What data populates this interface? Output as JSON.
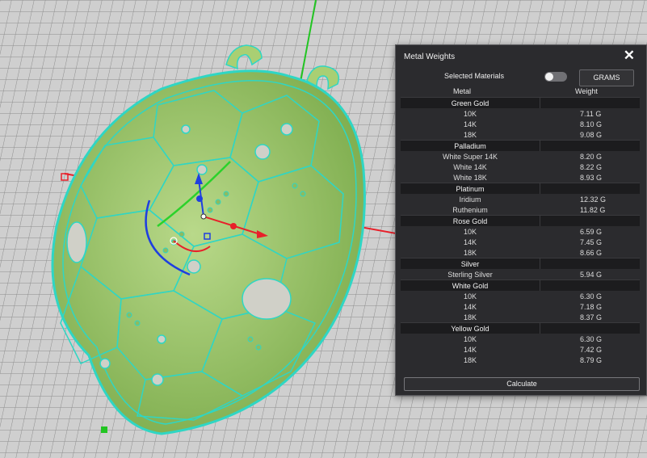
{
  "panel": {
    "title": "Metal Weights",
    "selected_materials_label": "Selected Materials",
    "unit_button": "GRAMS",
    "col_metal": "Metal",
    "col_weight": "Weight",
    "calculate_label": "Calculate",
    "groups": [
      {
        "name": "Green Gold",
        "rows": [
          {
            "metal": "10K",
            "weight": "7.11 G"
          },
          {
            "metal": "14K",
            "weight": "8.10 G"
          },
          {
            "metal": "18K",
            "weight": "9.08 G"
          }
        ]
      },
      {
        "name": "Palladium",
        "rows": [
          {
            "metal": "White Super 14K",
            "weight": "8.20 G"
          },
          {
            "metal": "White 14K",
            "weight": "8.22 G"
          },
          {
            "metal": "White 18K",
            "weight": "8.93 G"
          }
        ]
      },
      {
        "name": "Platinum",
        "rows": [
          {
            "metal": "Iridium",
            "weight": "12.32 G"
          },
          {
            "metal": "Ruthenium",
            "weight": "11.82 G"
          }
        ]
      },
      {
        "name": "Rose Gold",
        "rows": [
          {
            "metal": "10K",
            "weight": "6.59 G"
          },
          {
            "metal": "14K",
            "weight": "7.45 G"
          },
          {
            "metal": "18K",
            "weight": "8.66 G"
          }
        ]
      },
      {
        "name": "Silver",
        "rows": [
          {
            "metal": "Sterling Silver",
            "weight": "5.94 G"
          }
        ]
      },
      {
        "name": "White Gold",
        "rows": [
          {
            "metal": "10K",
            "weight": "6.30 G"
          },
          {
            "metal": "14K",
            "weight": "7.18 G"
          },
          {
            "metal": "18K",
            "weight": "8.37 G"
          }
        ]
      },
      {
        "name": "Yellow Gold",
        "rows": [
          {
            "metal": "10K",
            "weight": "6.30 G"
          },
          {
            "metal": "14K",
            "weight": "7.42 G"
          },
          {
            "metal": "18K",
            "weight": "8.79 G"
          }
        ]
      }
    ]
  },
  "colors": {
    "viewport_bg": "#cfcfcf",
    "grid_line": "#8a8a8a",
    "model_fill": "#9ec76a",
    "wire": "#2fd6c4",
    "panel_bg": "#2b2b2e",
    "axis_red": "#e8202a",
    "axis_green": "#2bd22b",
    "axis_blue": "#1e3fe0"
  }
}
